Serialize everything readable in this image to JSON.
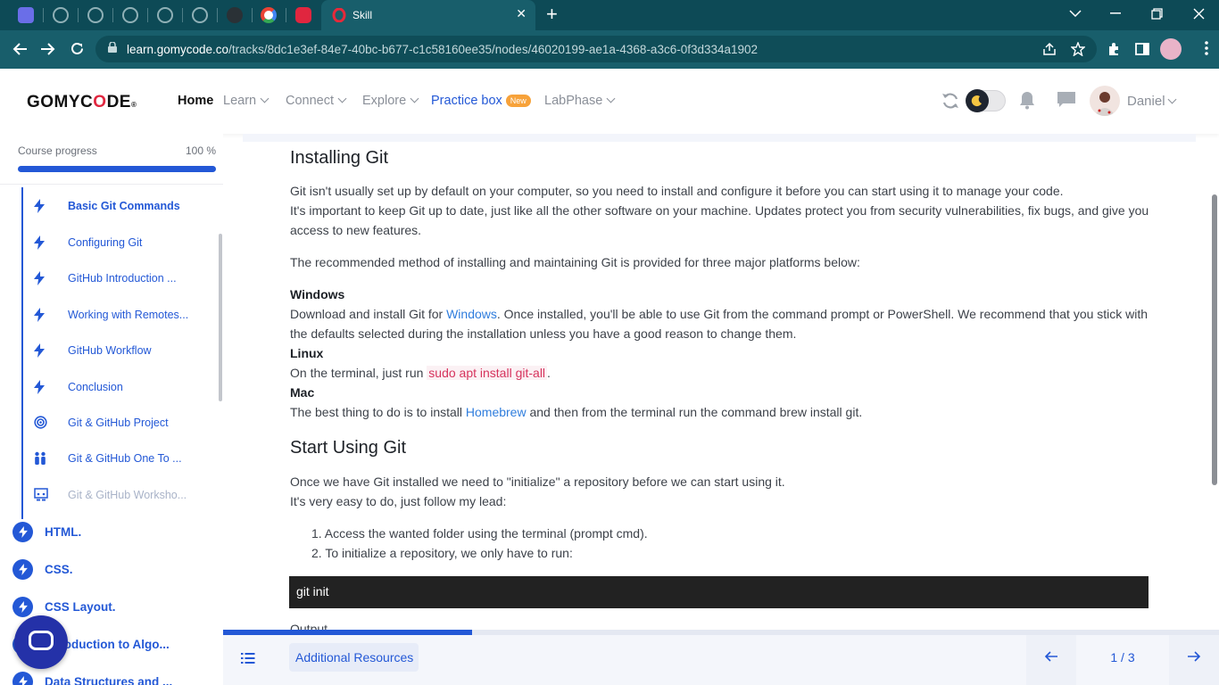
{
  "browser": {
    "active_tab_title": "Skill",
    "url_domain": "learn.gomycode.co",
    "url_path": "/tracks/8dc1e3ef-84e7-40bc-b677-c1c58160ee35/nodes/46020199-ae1a-4368-a3c6-0f3d334a1902",
    "new_tab_glyph": "+",
    "close_glyph": "✕"
  },
  "header": {
    "logo": {
      "pre": "GOMYC",
      "o": "O",
      "post": "DE",
      "reg": "®"
    },
    "nav": [
      {
        "label": "Home"
      },
      {
        "label": "Learn"
      },
      {
        "label": "Connect"
      },
      {
        "label": "Explore"
      },
      {
        "label": "Practice box",
        "badge": "New"
      },
      {
        "label": "LabPhase"
      }
    ],
    "username": "Daniel"
  },
  "sidebar": {
    "progress_label": "Course progress",
    "progress_value": "100 %",
    "progress_fraction": 1.0,
    "lessons": [
      {
        "label": "Basic Git Commands",
        "icon": "bolt-icon"
      },
      {
        "label": "Configuring Git",
        "icon": "bolt-icon"
      },
      {
        "label": "GitHub Introduction ...",
        "icon": "bolt-icon"
      },
      {
        "label": "Working with Remotes...",
        "icon": "bolt-icon"
      },
      {
        "label": "GitHub Workflow",
        "icon": "bolt-icon"
      },
      {
        "label": "Conclusion",
        "icon": "bolt-icon"
      },
      {
        "label": "Git & GitHub Project",
        "icon": "target-icon"
      },
      {
        "label": "Git & GitHub One To ...",
        "icon": "people-icon"
      },
      {
        "label": "Git & GitHub Worksho...",
        "icon": "workshop-icon"
      }
    ],
    "modules": [
      {
        "label": "HTML."
      },
      {
        "label": "CSS."
      },
      {
        "label": "CSS Layout."
      },
      {
        "label": "Introduction to Algo..."
      },
      {
        "label": "Data Structures and ..."
      }
    ]
  },
  "article": {
    "h_installing": "Installing Git",
    "p1": "Git isn't usually set up by default on your computer, so you need to install and configure it before you can start using it to manage your code.",
    "p2": "It's important to keep Git up to date, just like all the other software on your machine. Updates protect you from security vulnerabilities, fix bugs, and give you access to new features.",
    "p3": "The recommended method of installing and maintaining Git is provided for three major platforms below:",
    "windows_title": "Windows",
    "windows_pre": "Download and install Git for ",
    "windows_link": "Windows",
    "windows_post": ". Once installed, you'll be able to use Git from the command prompt or PowerShell. We recommend that you stick with the defaults selected during the installation unless you have a good reason to change them.",
    "linux_title": "Linux",
    "linux_pre": "On the terminal, just run ",
    "linux_code": "sudo apt install git-all",
    "linux_post": ".",
    "mac_title": "Mac",
    "mac_pre": "The best thing to do is to install ",
    "mac_link": "Homebrew",
    "mac_post": " and then from the terminal run the command brew install git.",
    "h_start": "Start Using Git",
    "p4": "Once we have Git installed we need to \"initialize\" a repository before we can start using it.",
    "p5": "It's very easy to do, just follow my lead:",
    "steps": [
      "1. Access the wanted folder using the terminal (prompt cmd).",
      "2. To initialize a repository, we only have to run:"
    ],
    "code": "git init",
    "output_label": "Output"
  },
  "footer": {
    "resources_label": "Additional Resources",
    "page_indicator": "1 / 3",
    "progress_fraction": 0.25
  },
  "colors": {
    "accent": "#2358d6",
    "browser_dark": "#0d4a56",
    "browser_bar": "#185e6b",
    "badge": "#f7a23a",
    "code_bg": "#222222",
    "inline_code": "#d6335d",
    "link": "#2f7ddd"
  }
}
